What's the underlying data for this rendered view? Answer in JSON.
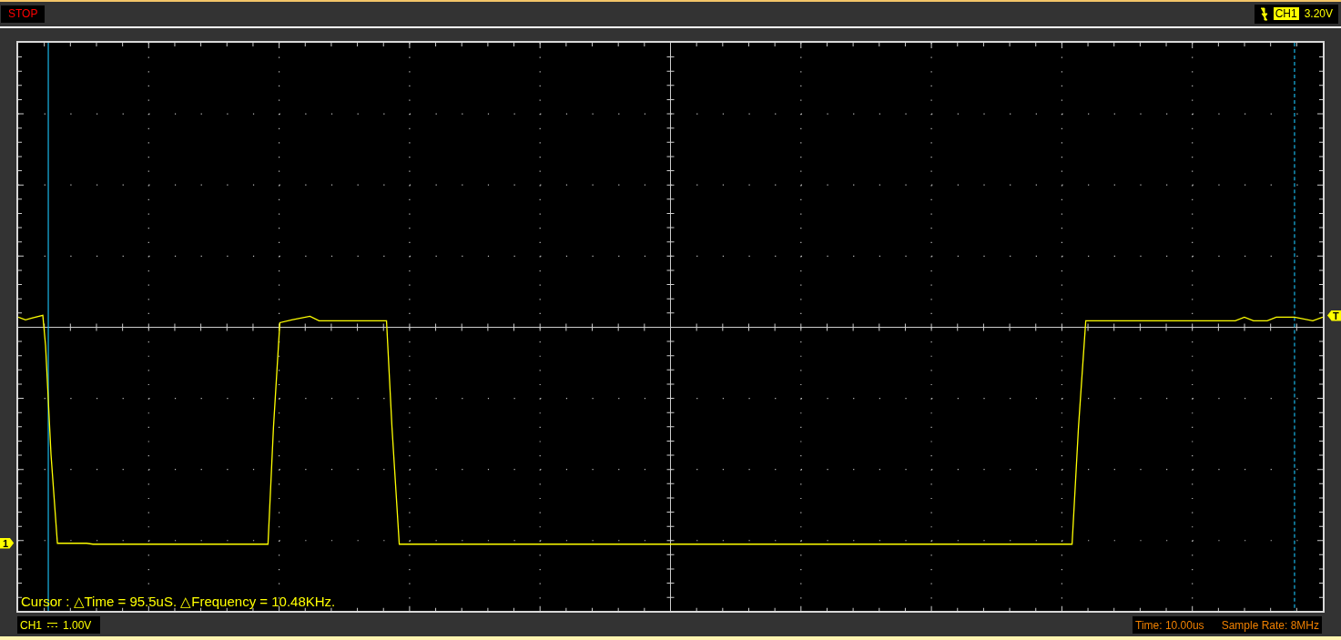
{
  "status": {
    "label": "STOP"
  },
  "trigger": {
    "channel": "CH1",
    "level": "3.20V"
  },
  "channel_marker": {
    "label": "1"
  },
  "trigger_marker": {
    "label": "T"
  },
  "cursor_readout": "Cursor : △Time = 95.5uS. △Frequency = 10.48KHz.",
  "channel_info": {
    "channel": "CH1",
    "scale": "1.00V"
  },
  "timebase": "Time: 10.00us",
  "sample_rate": "Sample Rate: 8MHz"
}
